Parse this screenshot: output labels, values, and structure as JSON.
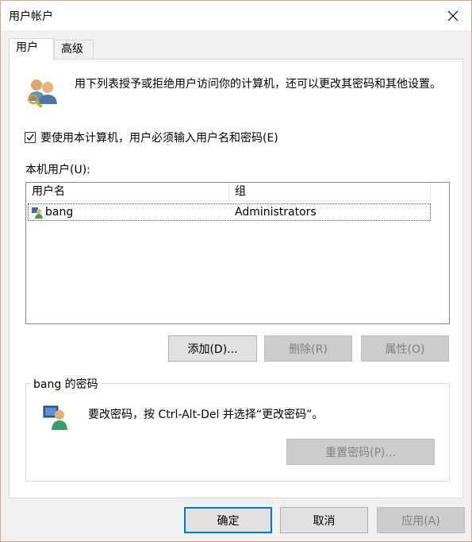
{
  "window": {
    "title": "用户帐户"
  },
  "tabs": [
    {
      "label": "用户"
    },
    {
      "label": "高级"
    }
  ],
  "intro": {
    "text": "用下列表授予或拒绝用户访问你的计算机，还可以更改其密码和其他设置。"
  },
  "require_login": {
    "checked": true,
    "label": "要使用本计算机，用户必须输入用户名和密码(E)"
  },
  "users": {
    "label": "本机用户(U):",
    "columns": [
      "用户名",
      "组"
    ],
    "rows": [
      {
        "name": "bang",
        "group": "Administrators"
      }
    ],
    "buttons": {
      "add": "添加(D)...",
      "remove": "删除(R)",
      "properties": "属性(O)"
    }
  },
  "password": {
    "group_title": "bang 的密码",
    "text": "要改密码，按 Ctrl-Alt-Del 并选择“更改密码”。",
    "reset_button": "重置密码(P)..."
  },
  "footer": {
    "ok": "确定",
    "cancel": "取消",
    "apply": "应用(A)"
  },
  "colors": {
    "accent": "#0078d7",
    "border": "#c9a98f"
  }
}
